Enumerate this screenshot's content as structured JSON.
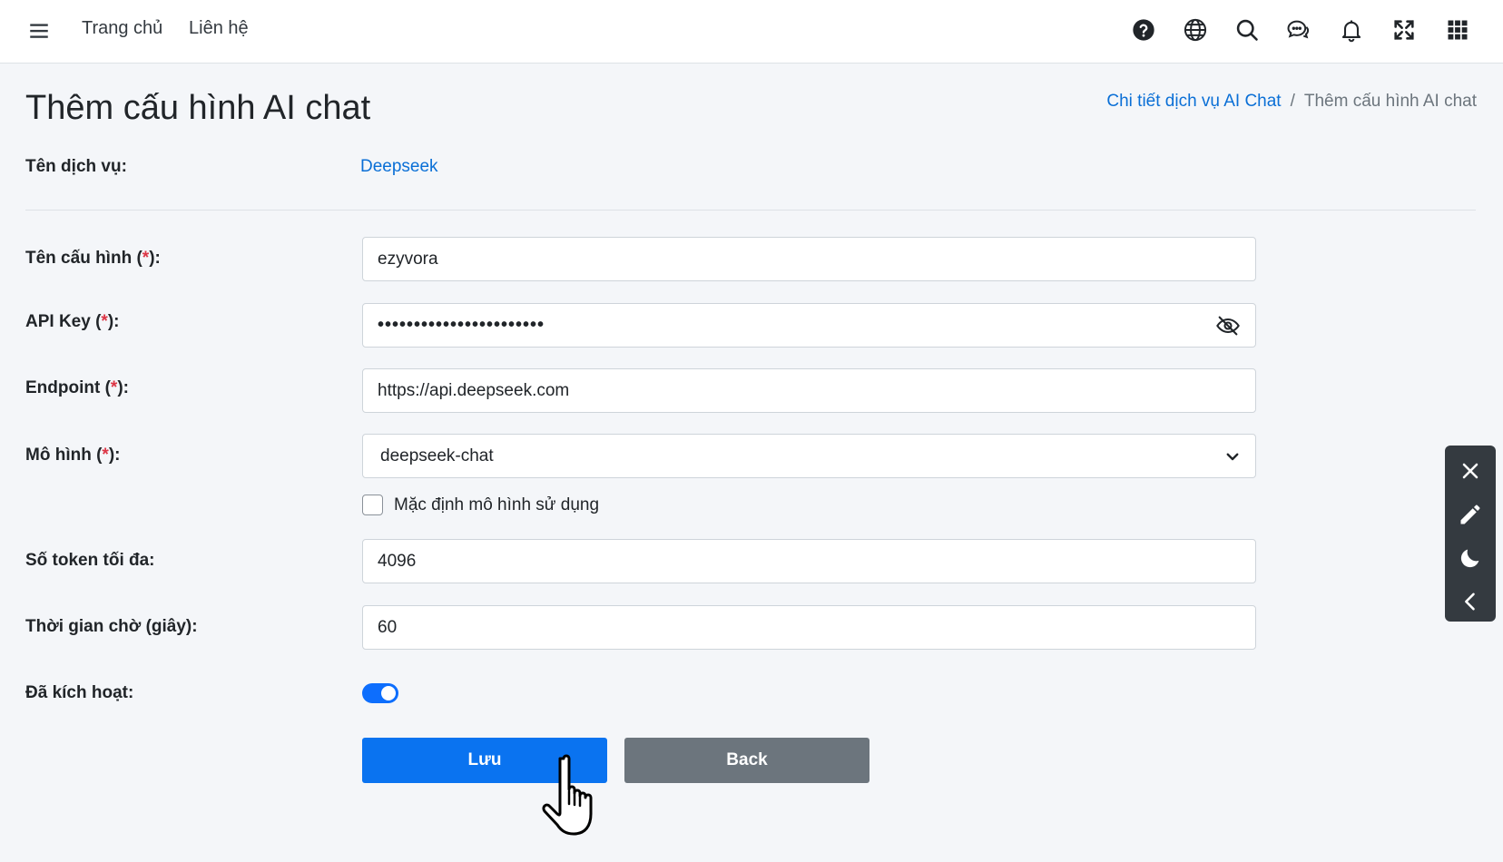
{
  "topbar": {
    "nav": [
      "Trang chủ",
      "Liên hệ"
    ],
    "icons": [
      "menu-icon",
      "help-icon",
      "globe-icon",
      "search-icon",
      "chat-icon",
      "bell-icon",
      "fullscreen-icon",
      "apps-grid-icon"
    ]
  },
  "page": {
    "title": "Thêm cấu hình AI chat"
  },
  "breadcrumb": {
    "link": "Chi tiết dịch vụ AI Chat",
    "separator": "/",
    "current": "Thêm cấu hình AI chat"
  },
  "service": {
    "label": "Tên dịch vụ:",
    "value": "Deepseek"
  },
  "form": {
    "config_name": {
      "label": "Tên cấu hình (",
      "required": "*",
      "suffix": "):",
      "value": "ezyvora"
    },
    "api_key": {
      "label": "API Key (",
      "required": "*",
      "suffix": "):",
      "masked_value": "•••••••••••••••••••••••"
    },
    "endpoint": {
      "label": "Endpoint (",
      "required": "*",
      "suffix": "):",
      "value": "https://api.deepseek.com"
    },
    "model": {
      "label": "Mô hình (",
      "required": "*",
      "suffix": "):",
      "selected": "deepseek-chat"
    },
    "default_model": {
      "label": "Mặc định mô hình sử dụng",
      "checked": false
    },
    "max_tokens": {
      "label": "Số token tối đa:",
      "value": "4096"
    },
    "timeout": {
      "label": "Thời gian chờ (giây):",
      "value": "60"
    },
    "active": {
      "label": "Đã kích hoạt:",
      "enabled": true
    }
  },
  "buttons": {
    "save": "Lưu",
    "back": "Back"
  },
  "side_panel": {
    "icons": [
      "close-icon",
      "pencil-icon",
      "moon-icon",
      "chevron-left-icon"
    ]
  },
  "colors": {
    "primary": "#0a73f0",
    "link": "#0a6fd6",
    "secondary": "#6c757d",
    "required": "#dc3545",
    "side_panel": "#343a40"
  }
}
